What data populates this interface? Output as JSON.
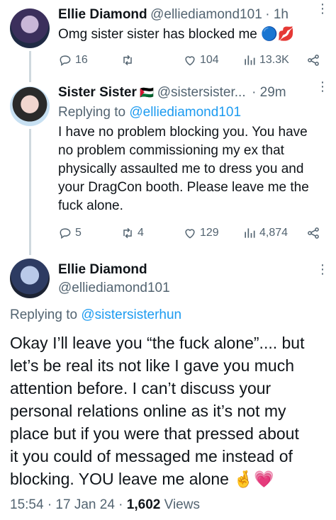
{
  "tweet1": {
    "name": "Ellie Diamond",
    "handle": "@elliediamond101",
    "time": "· 1h",
    "text": "Omg sister sister has blocked me",
    "emojis": "🔵💋",
    "replies": "16",
    "retweets": "",
    "likes": "104",
    "views": "13.3K"
  },
  "tweet2": {
    "name": "Sister Sister",
    "flag": "🇵🇸",
    "handle": "@sistersister...",
    "time": "· 29m",
    "replying_label": "Replying to",
    "replying_handle": "@elliediamond101",
    "text_lines": [
      "I have no problem blocking you. You have",
      "no problem commissioning my ex that",
      "physically assaulted me to dress you and",
      "your DragCon booth. Please leave me the",
      "fuck alone."
    ],
    "replies": "5",
    "retweets": "4",
    "likes": "129",
    "views": "4,874"
  },
  "tweet3": {
    "name": "Ellie Diamond",
    "handle": "@elliediamond101",
    "replying_label": "Replying to",
    "replying_handle": "@sistersisterhun",
    "text_lines": [
      "Okay I’ll leave you “the fuck alone”.... but",
      "let’s be real its not like I gave you much",
      "attention before. I can’t discuss your",
      "personal relations online as it’s not my",
      "place but if you were that pressed about",
      "it you could of messaged me instead of",
      "blocking. YOU leave me alone"
    ],
    "end_emojis": "🤞💗",
    "timestamp": "15:54 · 17 Jan 24 · ",
    "views_count": "1,602",
    "views_label": "Views"
  },
  "icons": [
    "reply-icon",
    "retweet-icon",
    "like-icon",
    "views-icon",
    "share-icon",
    "more-icon"
  ]
}
